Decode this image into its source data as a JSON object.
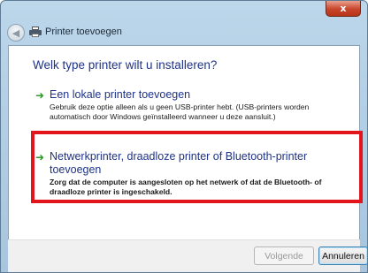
{
  "window": {
    "title": "Printer toevoegen",
    "close_label": "x"
  },
  "content": {
    "heading": "Welk type printer wilt u installeren?",
    "options": [
      {
        "title": "Een lokale printer toevoegen",
        "description": "Gebruik deze optie alleen als u geen USB-printer hebt. (USB-printers worden automatisch door Windows geïnstalleerd wanneer u deze aansluit.)"
      },
      {
        "title": "Netwerkprinter, draadloze printer of Bluetooth-printer toevoegen",
        "description": "Zorg dat de computer is aangesloten op het netwerk of dat de Bluetooth- of draadloze printer is ingeschakeld."
      }
    ]
  },
  "footer": {
    "next_label": "Volgende",
    "cancel_label": "Annuleren"
  },
  "colors": {
    "highlight": "#e3151c",
    "heading": "#1e3287",
    "arrow": "#2f9a2b"
  }
}
